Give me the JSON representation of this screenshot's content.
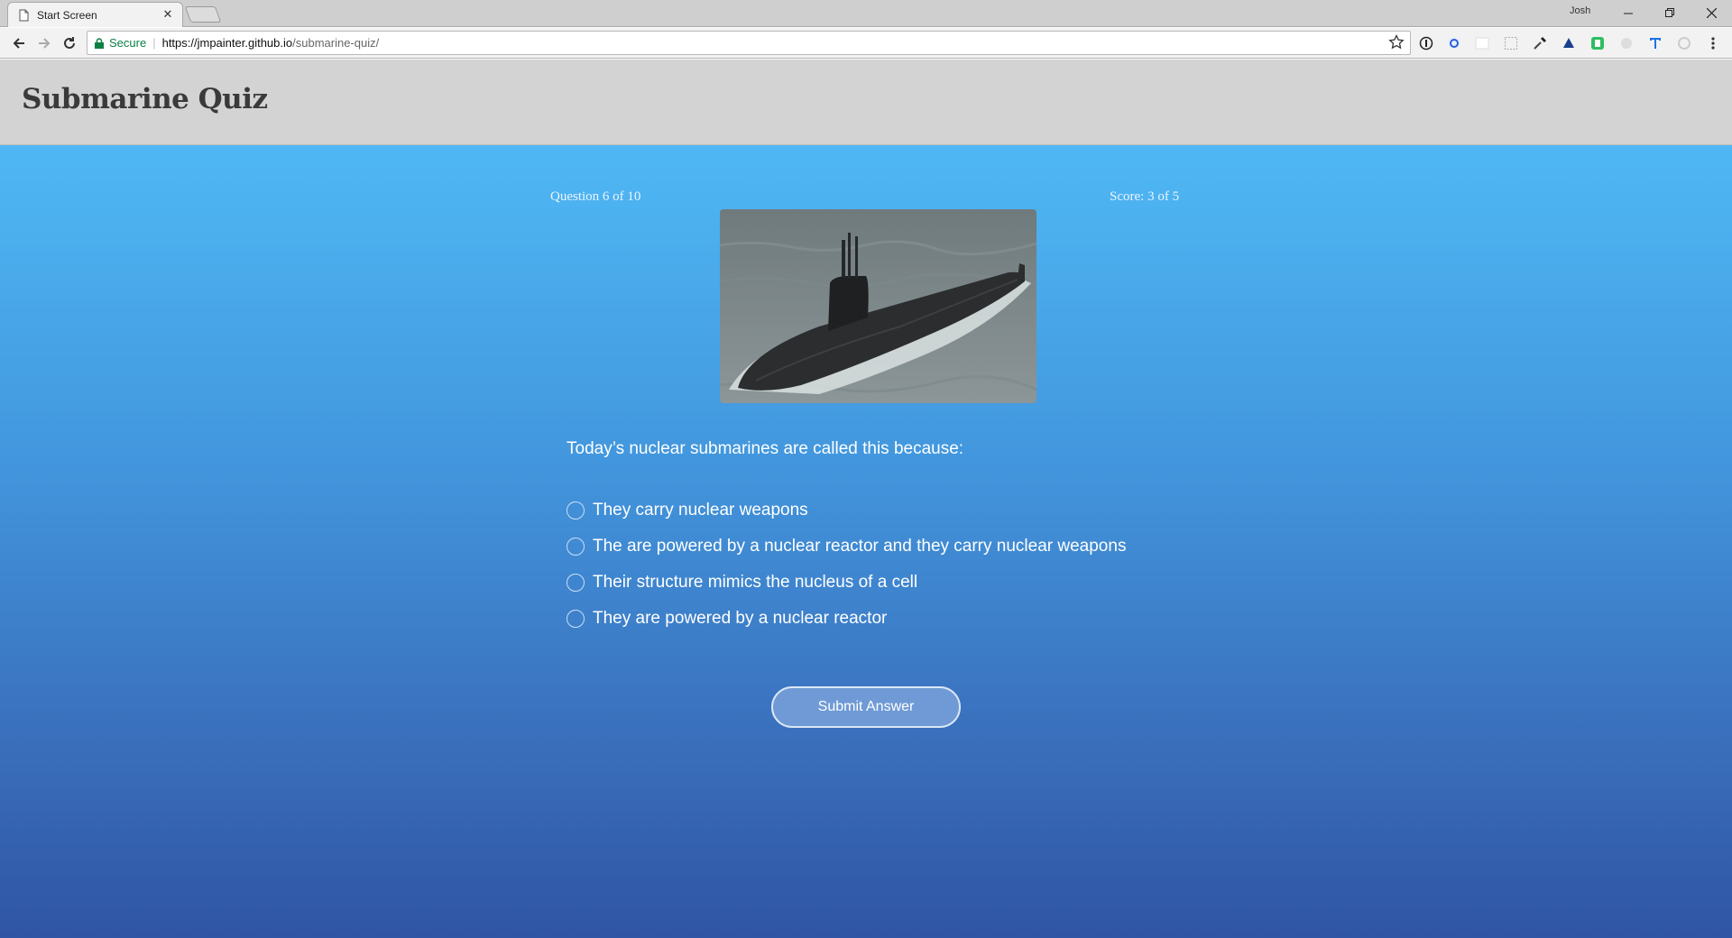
{
  "browser": {
    "tab_title": "Start Screen",
    "profile_name": "Josh",
    "security_label": "Secure",
    "url_host": "https://jmpainter.github.io",
    "url_path": "/submarine-quiz/"
  },
  "header": {
    "title": "Submarine Quiz"
  },
  "quiz": {
    "progress": "Question 6 of 10",
    "score": "Score: 3 of 5",
    "image_alt": "submarine-photo",
    "question": "Today’s nuclear submarines are called this because:",
    "options": [
      "They carry nuclear weapons",
      "The are powered by a nuclear reactor and they carry nuclear weapons",
      "Their structure mimics the nucleus of a cell",
      "They are powered by a nuclear reactor"
    ],
    "submit_label": "Submit Answer"
  },
  "colors": {
    "header_bg": "#d3d3d3",
    "gradient_top": "#4fb8f4",
    "gradient_bottom": "#2f55a4",
    "button_bg": "#6f9ad5"
  }
}
